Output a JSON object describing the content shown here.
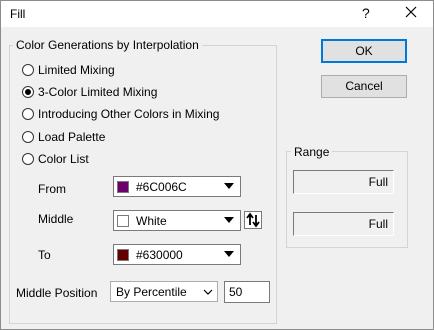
{
  "window": {
    "title": "Fill",
    "help_glyph": "?"
  },
  "group": {
    "title": "Color Generations by Interpolation",
    "options": [
      {
        "label": "Limited Mixing",
        "selected": false
      },
      {
        "label": "3-Color Limited Mixing",
        "selected": true
      },
      {
        "label": "Introducing Other Colors in Mixing",
        "selected": false
      },
      {
        "label": "Load Palette",
        "selected": false
      },
      {
        "label": "Color List",
        "selected": false
      }
    ],
    "from": {
      "label": "From",
      "value": "#6C006C",
      "color": "#6c006c"
    },
    "middle": {
      "label": "Middle",
      "value": "White",
      "color": "#ffffff",
      "swap_icon": "swap-vertical-icon"
    },
    "to": {
      "label": "To",
      "value": "#630000",
      "color": "#630000"
    },
    "middle_position": {
      "label": "Middle Position",
      "mode": "By Percentile",
      "value": "50"
    }
  },
  "buttons": {
    "ok": "OK",
    "cancel": "Cancel"
  },
  "range": {
    "title": "Range",
    "top": "Full",
    "bottom": "Full"
  }
}
